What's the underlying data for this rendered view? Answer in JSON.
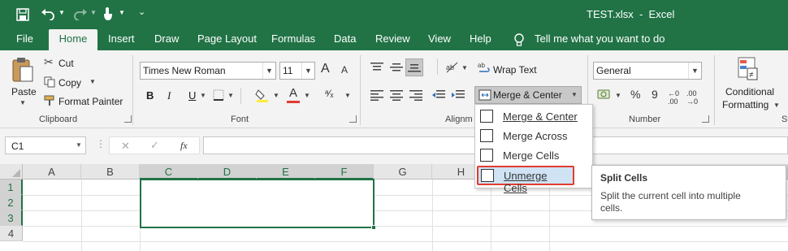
{
  "title_bar": {
    "title": "TEST.xlsx  -  Excel",
    "quick_access": [
      "save-icon",
      "undo-icon",
      "redo-icon",
      "touch-mode-icon",
      "customize-icon"
    ]
  },
  "menu": {
    "tabs": [
      "File",
      "Home",
      "Insert",
      "Draw",
      "Page Layout",
      "Formulas",
      "Data",
      "Review",
      "View",
      "Help"
    ],
    "tell_me": "Tell me what you want to do"
  },
  "ribbon": {
    "clipboard": {
      "paste": "Paste",
      "cut": "Cut",
      "copy": "Copy",
      "format_painter": "Format Painter",
      "label": "Clipboard"
    },
    "font": {
      "name": "Times New Roman",
      "size": "11",
      "label": "Font",
      "grow": "A",
      "shrink": "A",
      "bold": "B",
      "italic": "I",
      "underline": "U",
      "font_color": "A"
    },
    "alignment": {
      "wrap_text": "Wrap Text",
      "merge_center": "Merge & Center",
      "label": "Alignm"
    },
    "number": {
      "format": "General",
      "label": "Number",
      "currency": "$",
      "percent": "%",
      "comma": "9"
    },
    "styles": {
      "conditional": "Conditional",
      "formatting": "Formatting",
      "label_partial": "St"
    }
  },
  "formula_bar": {
    "name_box": "C1",
    "fx": "fx",
    "value": ""
  },
  "grid": {
    "columns": [
      "A",
      "B",
      "C",
      "D",
      "E",
      "F",
      "G",
      "H"
    ],
    "rows": [
      "1",
      "2",
      "3",
      "4"
    ]
  },
  "merge_menu": {
    "items": [
      "Merge & Center",
      "Merge Across",
      "Merge Cells",
      "Unmerge Cells"
    ],
    "highlighted": "Unmerge Cells"
  },
  "tooltip": {
    "title": "Split Cells",
    "body": "Split the current cell into multiple cells."
  },
  "colors": {
    "excel_green": "#217346",
    "highlight_red": "#e03c31",
    "selected_item": "#cfe3f4"
  }
}
